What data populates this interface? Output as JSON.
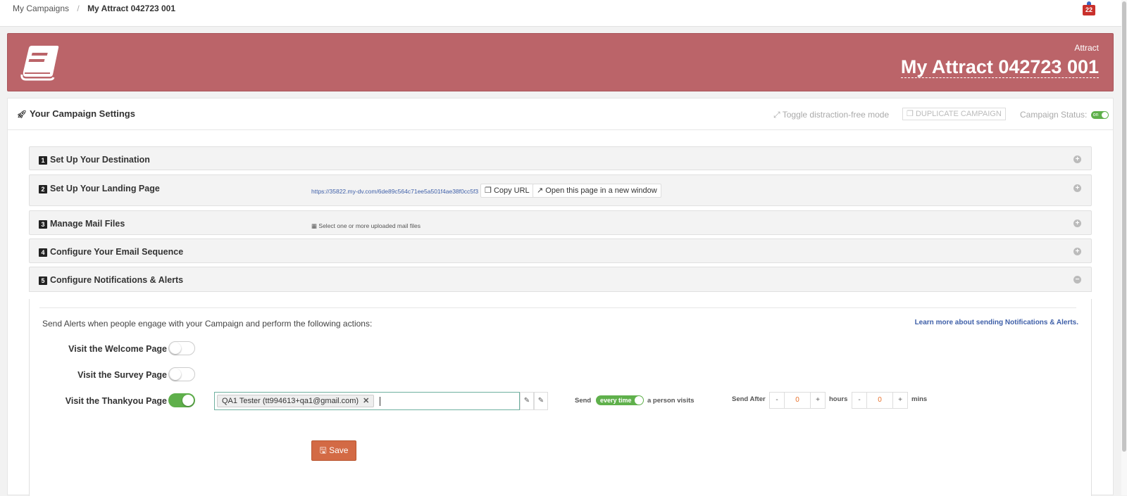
{
  "breadcrumb": {
    "parent": "My Campaigns",
    "separator": "/",
    "current": "My Attract 042723 001"
  },
  "notifications": {
    "count": "22"
  },
  "header": {
    "type": "Attract",
    "title": "My Attract 042723 001",
    "color": "#bb6469"
  },
  "settings": {
    "title": "Your Campaign Settings",
    "toggle_distraction": "Toggle distraction-free mode",
    "duplicate": "DUPLICATE CAMPAIGN",
    "status_label": "Campaign Status:",
    "status_toggle": "on"
  },
  "sections": [
    {
      "num": "1",
      "label": "Set Up Your Destination"
    },
    {
      "num": "2",
      "label": "Set Up Your Landing Page",
      "url": "https://35822.my-dv.com/6de89c564c71ee5a501f4ae38f0cc5f3",
      "copy_url": "Copy URL",
      "open_window": "Open this page in a new window"
    },
    {
      "num": "3",
      "label": "Manage Mail Files",
      "hint": "Select one or more uploaded mail files"
    },
    {
      "num": "4",
      "label": "Configure Your Email Sequence"
    },
    {
      "num": "5",
      "label": "Configure Notifications & Alerts"
    }
  ],
  "alerts": {
    "intro": "Send Alerts when people engage with your Campaign and perform the following actions:",
    "learn_more": "Learn more about sending Notifications & Alerts.",
    "rows": [
      {
        "label": "Visit the Welcome Page",
        "enabled": false
      },
      {
        "label": "Visit the Survey Page",
        "enabled": false
      },
      {
        "label": "Visit the Thankyou Page",
        "enabled": true
      }
    ],
    "recipient_tag": "QA1 Tester (tt994613+qa1@gmail.com)",
    "send_label": "Send",
    "frequency": "every time",
    "frequency_suffix": "a person visits",
    "send_after_label": "Send After",
    "hours_value": "0",
    "hours_label": "hours",
    "mins_value": "0",
    "mins_label": "mins",
    "minus": "-",
    "plus": "+",
    "save": "Save"
  },
  "colors": {
    "accent_green": "#5fb04b",
    "save_orange": "#d36a45",
    "link_blue": "#3e5fa8"
  }
}
